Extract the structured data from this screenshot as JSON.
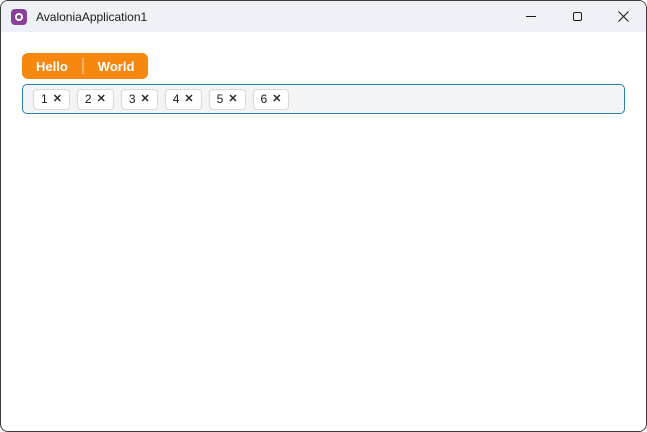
{
  "window": {
    "title": "AvaloniaApplication1",
    "controls": [
      {
        "name": "minimize"
      },
      {
        "name": "maximize"
      },
      {
        "name": "close"
      }
    ]
  },
  "tabs": [
    {
      "label": "Hello",
      "selected": true
    },
    {
      "label": "World",
      "selected": false
    }
  ],
  "tagbox": {
    "chips": [
      {
        "label": "1"
      },
      {
        "label": "2"
      },
      {
        "label": "3"
      },
      {
        "label": "4"
      },
      {
        "label": "5"
      },
      {
        "label": "6"
      }
    ]
  },
  "icons": {
    "app_logo": "avalonia-logo",
    "chip_close": "✕"
  },
  "colors": {
    "accent_orange": "#F6870F",
    "tab_divider": "rgba(255,255,255,0.38)",
    "tagbox_border": "#2E7DB2",
    "tagbox_background": "#F2F4F5",
    "chip_background": "#FFFFFF",
    "chip_border": "#D8D8D8",
    "titlebar_background": "#EEF2F7",
    "window_border": "#3C3C3C",
    "logo_purple": "#8C3F98",
    "text": "#1A1A1A"
  }
}
